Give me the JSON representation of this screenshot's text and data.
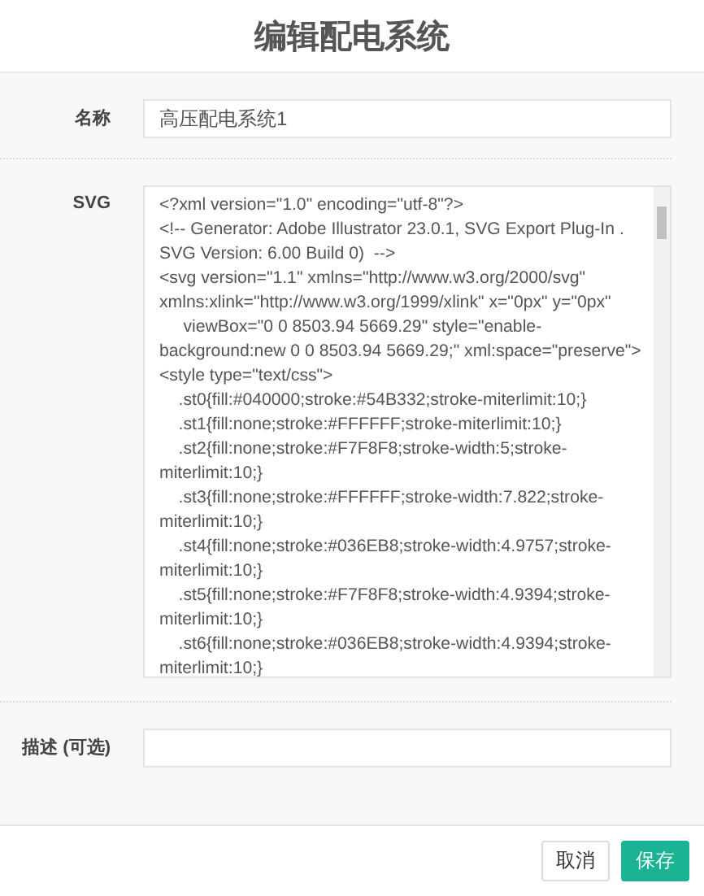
{
  "dialog": {
    "title": "编辑配电系统"
  },
  "form": {
    "fields": [
      {
        "kind": "input",
        "label": "名称",
        "value": "高压配电系统1"
      },
      {
        "kind": "code",
        "label": "SVG",
        "value": "<?xml version=\"1.0\" encoding=\"utf-8\"?>\n<!-- Generator: Adobe Illustrator 23.0.1, SVG Export Plug-In . SVG Version: 6.00 Build 0)  -->\n<svg version=\"1.1\" xmlns=\"http://www.w3.org/2000/svg\" xmlns:xlink=\"http://www.w3.org/1999/xlink\" x=\"0px\" y=\"0px\"\n\t viewBox=\"0 0 8503.94 5669.29\" style=\"enable-background:new 0 0 8503.94 5669.29;\" xml:space=\"preserve\">\n<style type=\"text/css\">\n\t.st0{fill:#040000;stroke:#54B332;stroke-miterlimit:10;}\n\t.st1{fill:none;stroke:#FFFFFF;stroke-miterlimit:10;}\n\t.st2{fill:none;stroke:#F7F8F8;stroke-width:5;stroke-miterlimit:10;}\n\t.st3{fill:none;stroke:#FFFFFF;stroke-width:7.822;stroke-miterlimit:10;}\n\t.st4{fill:none;stroke:#036EB8;stroke-width:4.9757;stroke-miterlimit:10;}\n\t.st5{fill:none;stroke:#F7F8F8;stroke-width:4.9394;stroke-miterlimit:10;}\n\t.st6{fill:none;stroke:#036EB8;stroke-width:4.9394;stroke-miterlimit:10;}"
      },
      {
        "kind": "input",
        "label": "描述 (可选)"
      }
    ]
  },
  "buttons": [
    {
      "label": "取消",
      "kind": "secondary"
    },
    {
      "label": "保存",
      "kind": "primary"
    }
  ]
}
